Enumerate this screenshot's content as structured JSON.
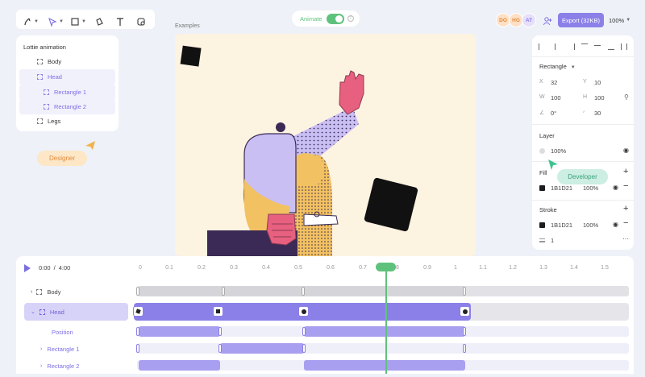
{
  "toolbar": {
    "tools": [
      "pen-tool",
      "select-tool",
      "shape-tool",
      "fill-tool",
      "text-tool",
      "component-tool"
    ]
  },
  "animate": {
    "label": "Animate",
    "enabled": true
  },
  "header": {
    "avatars": [
      "DO",
      "HG",
      "AT"
    ],
    "export_label": "Export (32KB)",
    "zoom": "100%"
  },
  "layers": {
    "title": "Lottie animation",
    "items": [
      {
        "label": "Body"
      },
      {
        "label": "Head"
      },
      {
        "label": "Rectangle 1"
      },
      {
        "label": "Rectangle 2"
      },
      {
        "label": "Legs"
      }
    ]
  },
  "cursors": {
    "designer": "Designer",
    "developer": "Developer"
  },
  "canvas": {
    "label": "Examples"
  },
  "props": {
    "shape_type": "Rectangle",
    "x_label": "X",
    "x": "32",
    "y_label": "Y",
    "y": "10",
    "w_label": "W",
    "w": "100",
    "h_label": "H",
    "h": "100",
    "rotation": "0°",
    "radius": "30",
    "layer_title": "Layer",
    "opacity": "100%",
    "fill_title": "Fill",
    "fill_hex": "1B1D21",
    "fill_opacity": "100%",
    "stroke_title": "Stroke",
    "stroke_hex": "1B1D21",
    "stroke_opacity": "100%",
    "stroke_width": "1"
  },
  "timeline": {
    "current": "0:00",
    "separator": "/",
    "total": "4:00",
    "ticks": [
      "0",
      "0.1",
      "0.2",
      "0.3",
      "0.4",
      "0.5",
      "0.6",
      "0.7",
      "0.8",
      "0.9",
      "1",
      "1.1",
      "1.2",
      "1.3",
      "1.4",
      "1.5"
    ],
    "rows": [
      {
        "label": "Body"
      },
      {
        "label": "Head"
      },
      {
        "label": "Position"
      },
      {
        "label": "Rectangle 1"
      },
      {
        "label": "Rectangle 2"
      }
    ]
  },
  "colors": {
    "accent": "#8b80e8",
    "accent_light": "#a99ff0",
    "green": "#5fc27c",
    "canvas_bg": "#fdf3e1"
  }
}
